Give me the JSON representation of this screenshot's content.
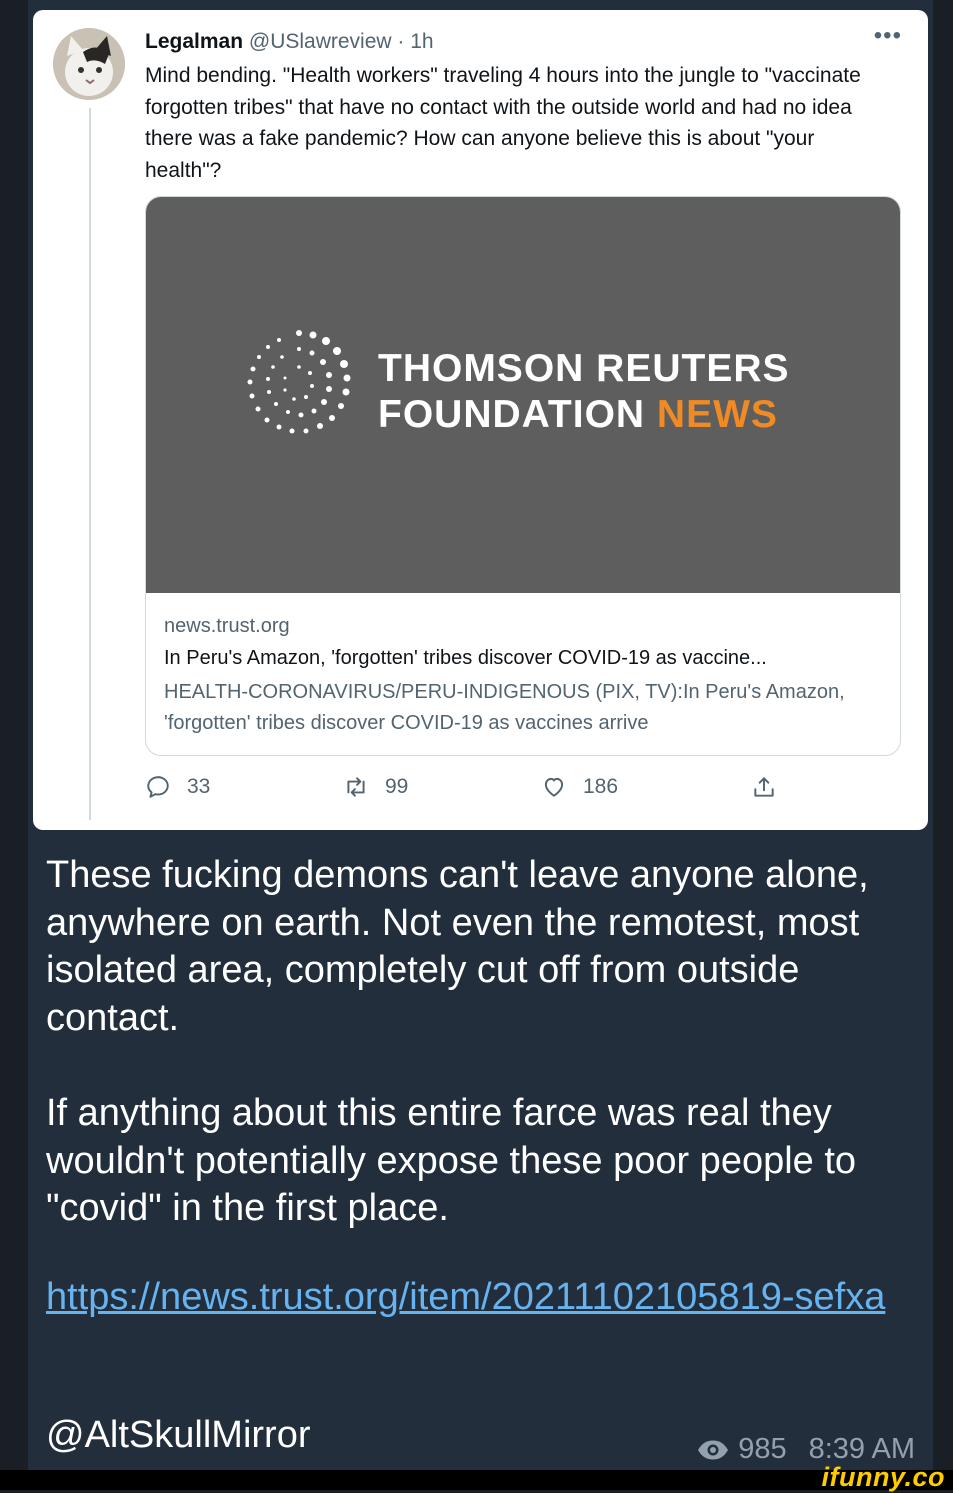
{
  "tweet": {
    "name": "Legalman",
    "handle": "@USlawreview",
    "separator": " · ",
    "time": "1h",
    "more": "•••",
    "text": "Mind bending. \"Health workers\" traveling 4 hours into the jungle to \"vaccinate forgotten tribes\" that have no contact with the outside world and had no idea there was a fake pandemic? How can anyone believe this is about \"your health\"?",
    "card": {
      "logo_line1": "THOMSON REUTERS",
      "logo_line2_a": "FOUNDATION ",
      "logo_line2_b": "NEWS",
      "domain": "news.trust.org",
      "title": "In Peru's Amazon, 'forgotten' tribes discover COVID-19 as vaccine...",
      "description": "HEALTH-CORONAVIRUS/PERU-INDIGENOUS (PIX, TV):In Peru's Amazon, 'forgotten' tribes discover COVID-19 as vaccines arrive"
    },
    "actions": {
      "replies": "33",
      "retweets": "99",
      "likes": "186"
    }
  },
  "message": {
    "paragraph1": "These fucking demons can't leave anyone alone, anywhere on earth. Not even the remotest, most isolated area, completely cut off from outside contact.",
    "paragraph2": "If anything about this entire farce was real they wouldn't potentially expose these poor people to \"covid\" in the first place.",
    "link": "https://news.trust.org/item/20211102105819-sefxa",
    "signature": "@AltSkullMirror",
    "views": "985",
    "time": "8:39 AM"
  },
  "watermark": "ifunny.co",
  "colors": {
    "background": "#232e3c",
    "link": "#66b3f0",
    "news_accent": "#f08a24",
    "watermark": "#ffcc00"
  }
}
